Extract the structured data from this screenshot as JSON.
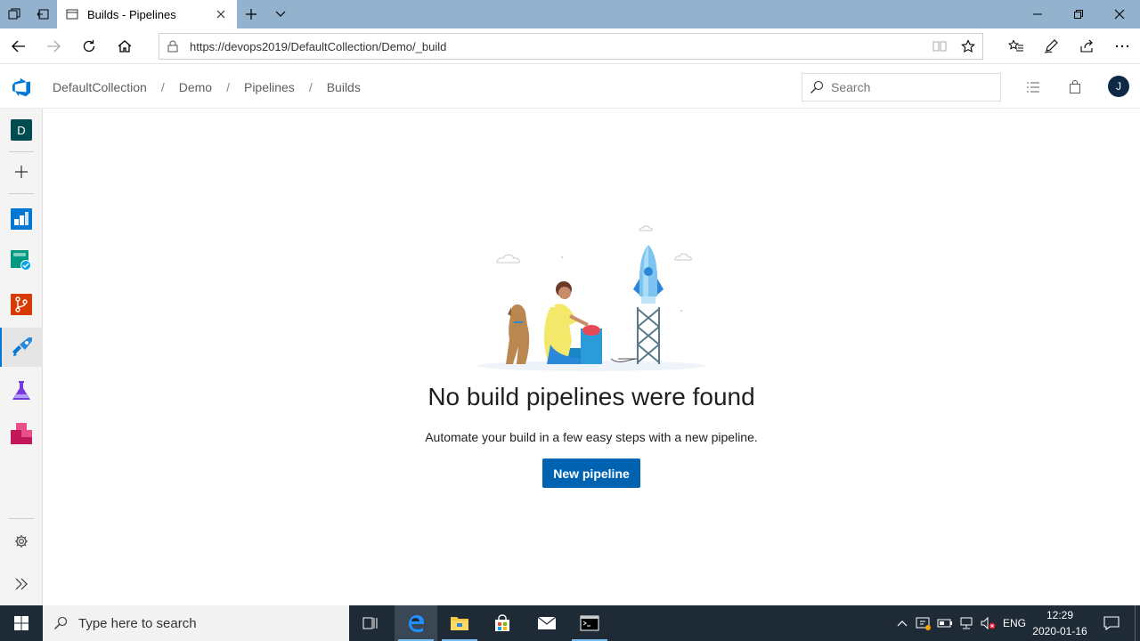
{
  "browser": {
    "tab_title": "Builds - Pipelines",
    "url": "https://devops2019/DefaultCollection/Demo/_build"
  },
  "header": {
    "breadcrumbs": [
      "DefaultCollection",
      "Demo",
      "Pipelines",
      "Builds"
    ],
    "search_placeholder": "Search",
    "user_initial": "J"
  },
  "rail": {
    "project_initial": "D",
    "items": [
      "boards-icon",
      "test-plans-icon",
      "repos-icon",
      "pipelines-icon",
      "test-icon",
      "artifacts-icon"
    ]
  },
  "main": {
    "empty_title": "No build pipelines were found",
    "empty_desc": "Automate your build in a few easy steps with a new pipeline.",
    "new_pipeline_label": "New pipeline"
  },
  "taskbar": {
    "search_placeholder": "Type here to search",
    "language": "ENG",
    "time": "12:29",
    "date": "2020-01-16"
  },
  "colors": {
    "accent": "#0078d4",
    "button": "#0063b1",
    "tab_strip": "#93b2ce",
    "taskbar": "#1f2a37"
  }
}
